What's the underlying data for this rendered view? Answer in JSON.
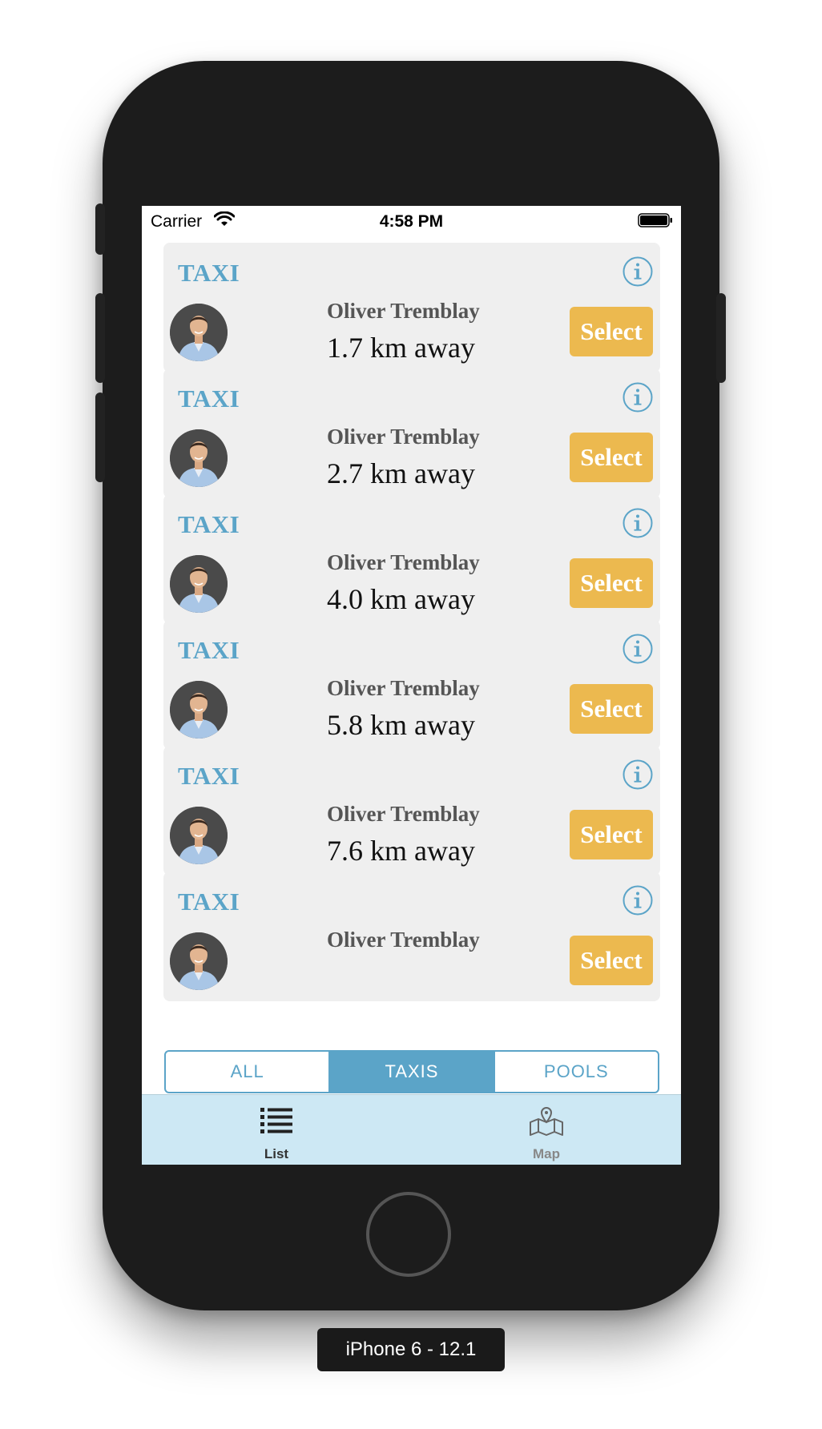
{
  "status_bar": {
    "carrier": "Carrier",
    "time": "4:58 PM",
    "wifi_icon": "wifi-icon",
    "battery_icon": "battery-icon"
  },
  "cards": [
    {
      "type": "TAXI",
      "driver": "Oliver Tremblay",
      "distance": "1.7 km away",
      "button": "Select"
    },
    {
      "type": "TAXI",
      "driver": "Oliver Tremblay",
      "distance": "2.7 km away",
      "button": "Select"
    },
    {
      "type": "TAXI",
      "driver": "Oliver Tremblay",
      "distance": "4.0 km away",
      "button": "Select"
    },
    {
      "type": "TAXI",
      "driver": "Oliver Tremblay",
      "distance": "5.8 km away",
      "button": "Select"
    },
    {
      "type": "TAXI",
      "driver": "Oliver Tremblay",
      "distance": "7.6 km away",
      "button": "Select"
    },
    {
      "type": "TAXI",
      "driver": "Oliver Tremblay",
      "distance": "",
      "button": "Select"
    }
  ],
  "filter": {
    "options": [
      "ALL",
      "TAXIS",
      "POOLS"
    ],
    "selected": "TAXIS"
  },
  "tab_bar": {
    "list_label": "List",
    "map_label": "Map"
  },
  "device_label": "iPhone 6 - 12.1",
  "colors": {
    "accent": "#5ba4c8",
    "select_button": "#ecb94f",
    "card_background": "#efefef",
    "tab_bar_background": "#cde8f4"
  }
}
